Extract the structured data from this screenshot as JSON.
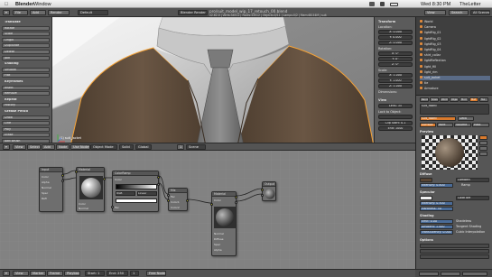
{
  "menubar": {
    "apple": "",
    "app_name": "Blender",
    "menu_window": "Window",
    "clock": "Wed 8:30 PM",
    "user": "TheLetter"
  },
  "titlebar": {
    "title": "pro/suit_model_wip_17_retouch_00.blend",
    "editor_type": "Blender Render",
    "info": "v2.62.0 | Verts:34512 | Faces:33512 | Objects:0/11 | Lamps:0/2 | Mem:68.54M | suit"
  },
  "toolshelf": {
    "rows": [
      "Translate",
      "Rotate",
      "Scale",
      "Origin",
      "Duplicate",
      "Delete",
      "Join",
      "Shading",
      "Smooth",
      "Flat",
      "Keyframes",
      "Insert",
      "Remove",
      "Repeat",
      "History",
      "Grease Pencil",
      "Draw",
      "Line",
      "Poly",
      "Erase",
      "Add Brush"
    ]
  },
  "viewport": {
    "mode_label": "Object Mode",
    "object_label": "(1) suit_jacket",
    "shading": "Solid",
    "pivot": "Global",
    "layer": "1",
    "scene_label": "Scene"
  },
  "nprops": {
    "transform_title": "Transform",
    "location_label": "Location:",
    "loc": [
      "X: 0.000",
      "Y: 0.000",
      "Z: 0.000"
    ],
    "rotation_label": "Rotation:",
    "rot": [
      "X: 0°",
      "Y: 0°",
      "Z: 0°"
    ],
    "scale_label": "Scale:",
    "scl": [
      "X: 1.000",
      "Y: 1.000",
      "Z: 1.000"
    ],
    "dimensions_label": "Dimensions:",
    "view_title": "View",
    "lens": "Lens: 35",
    "lock_label": "Lock to Object:",
    "clip_start": "Clip Start: 0.1",
    "clip_end": "End: 1000"
  },
  "outliner": {
    "header_view": "View",
    "header_search": "Search",
    "header_scenes": "All Scenes",
    "items": [
      "World",
      "Camera",
      "lightRig_01",
      "lightRig_02",
      "lightRig_03",
      "lightRig_04",
      "shirt_collar",
      "lightReflection",
      "light_fill",
      "light_rim",
      "suit_jacket",
      "tie",
      "Armature"
    ]
  },
  "properties": {
    "tabs_row": [
      "Render",
      "Scene",
      "World",
      "Object",
      "Mod",
      "Mat",
      "Tex"
    ],
    "material_slot": "suit_fabric",
    "new_button": "Data",
    "material_name": "suit_fabric",
    "surface_btn": "Surface",
    "wire_btn": "Wire",
    "volume_btn": "Volume",
    "halo_btn": "Halo",
    "preview_title": "Preview",
    "diffuse_title": "Diffuse",
    "diffuse_model": "Lambert",
    "intensity": "Intensity: 0.800",
    "ramp": "Ramp",
    "specular_title": "Specular",
    "spec_model": "CookTorr",
    "spec_intensity": "Intensity: 0.500",
    "hardness": "Hardness: 50",
    "shading_title": "Shading",
    "emit": "Emit: 0.00",
    "ambient": "Ambient: 1.000",
    "translucency": "Translucency: 0.000",
    "shadeless": "Shadeless",
    "tangent": "Tangent Shading",
    "cubic": "Cubic Interpolation",
    "options_title": "Options"
  },
  "nodeeditor": {
    "header_items": [
      "View",
      "Select",
      "Add",
      "Node",
      "Use Nodes"
    ],
    "nodes": {
      "input": {
        "title": "Input",
        "labels": [
          "Color",
          "Alpha",
          "Normal",
          "Spec",
          "Refl"
        ]
      },
      "material": {
        "title": "Material",
        "labels": [
          "Color",
          "Spec",
          "Refl",
          "Normal"
        ]
      },
      "ramp": {
        "title": "ColorRamp",
        "labels": [
          "Fac",
          "Color",
          "Alpha",
          "Linear",
          "RGB"
        ]
      },
      "mix": {
        "title": "Mix",
        "labels": [
          "Fac",
          "Color1",
          "Color2"
        ]
      },
      "material2": {
        "title": "Material",
        "labels": [
          "Color",
          "Alpha",
          "Normal",
          "Diffuse",
          "Spec"
        ]
      },
      "output": {
        "title": "Output",
        "labels": [
          "Color",
          "Alpha"
        ]
      }
    }
  },
  "timeline": {
    "items": [
      "View",
      "Marker",
      "Frame",
      "Playback"
    ],
    "start": "Start: 1",
    "end": "End: 250",
    "frame": "1",
    "free_nodes": "Free Nodes"
  },
  "colors": {
    "accent": "#d97a2d",
    "suit": "#5b4a3a",
    "selected_outline": "#f5a236"
  }
}
